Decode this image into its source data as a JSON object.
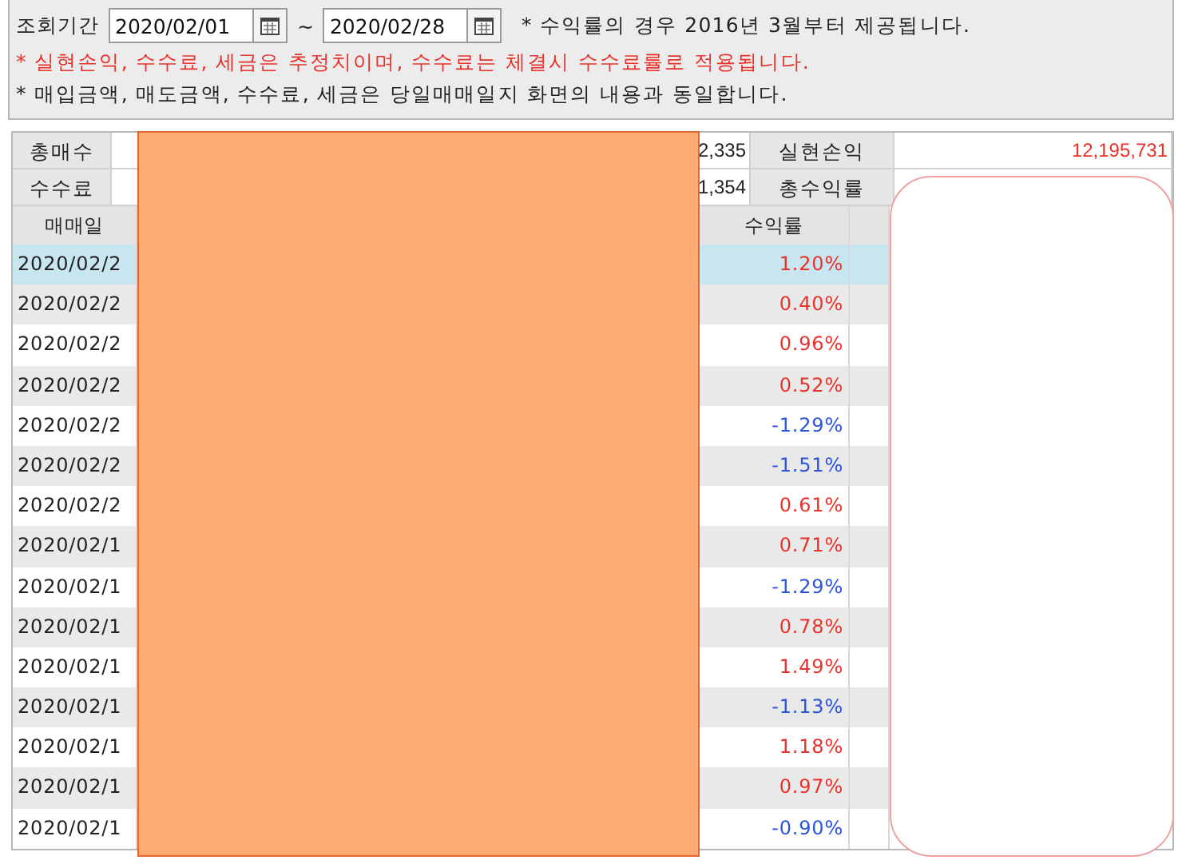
{
  "filter": {
    "label": "조회기간",
    "start_date": "2020/02/01",
    "separator": "~",
    "end_date": "2020/02/28",
    "note": "* 수익률의 경우 2016년 3월부터 제공됩니다.",
    "warning": "* 실현손익, 수수료, 세금은 추정치이며, 수수료는 체결시 수수료률로 적용됩니다.",
    "info": "* 매입금액, 매도금액, 수수료, 세금은 당일매매일지 화면의 내용과 동일합니다."
  },
  "summary": [
    {
      "label": "총매수",
      "value": "2,335",
      "label_2": "실현손익",
      "value_2": "12,195,731"
    },
    {
      "label": "수수료",
      "value": "1,354",
      "label_2": "총수익률"
    }
  ],
  "table": {
    "columns": [
      "매매일",
      "수익률"
    ],
    "rows": [
      {
        "date": "2020/02/2",
        "rate": "1.20%",
        "color": "#e8322c",
        "selected": true
      },
      {
        "date": "2020/02/2",
        "rate": "0.40%",
        "color": "#e8322c",
        "selected": false
      },
      {
        "date": "2020/02/2",
        "rate": "0.96%",
        "color": "#e8322c",
        "selected": false
      },
      {
        "date": "2020/02/2",
        "rate": "0.52%",
        "color": "#e8322c",
        "selected": false
      },
      {
        "date": "2020/02/2",
        "rate": "-1.29%",
        "color": "#2b55d6",
        "selected": false
      },
      {
        "date": "2020/02/2",
        "rate": "-1.51%",
        "color": "#2b55d6",
        "selected": false
      },
      {
        "date": "2020/02/2",
        "rate": "0.61%",
        "color": "#e8322c",
        "selected": false
      },
      {
        "date": "2020/02/1",
        "rate": "0.71%",
        "color": "#e8322c",
        "selected": false
      },
      {
        "date": "2020/02/1",
        "rate": "-1.29%",
        "color": "#2b55d6",
        "selected": false
      },
      {
        "date": "2020/02/1",
        "rate": "0.78%",
        "color": "#e8322c",
        "selected": false
      },
      {
        "date": "2020/02/1",
        "rate": "1.49%",
        "color": "#e8322c",
        "selected": false
      },
      {
        "date": "2020/02/1",
        "rate": "-1.13%",
        "color": "#2b55d6",
        "selected": false
      },
      {
        "date": "2020/02/1",
        "rate": "1.18%",
        "color": "#e8322c",
        "selected": false
      },
      {
        "date": "2020/02/1",
        "rate": "0.97%",
        "color": "#e8322c",
        "selected": false
      },
      {
        "date": "2020/02/1",
        "rate": "-0.90%",
        "color": "#2b55d6",
        "selected": false
      }
    ]
  }
}
